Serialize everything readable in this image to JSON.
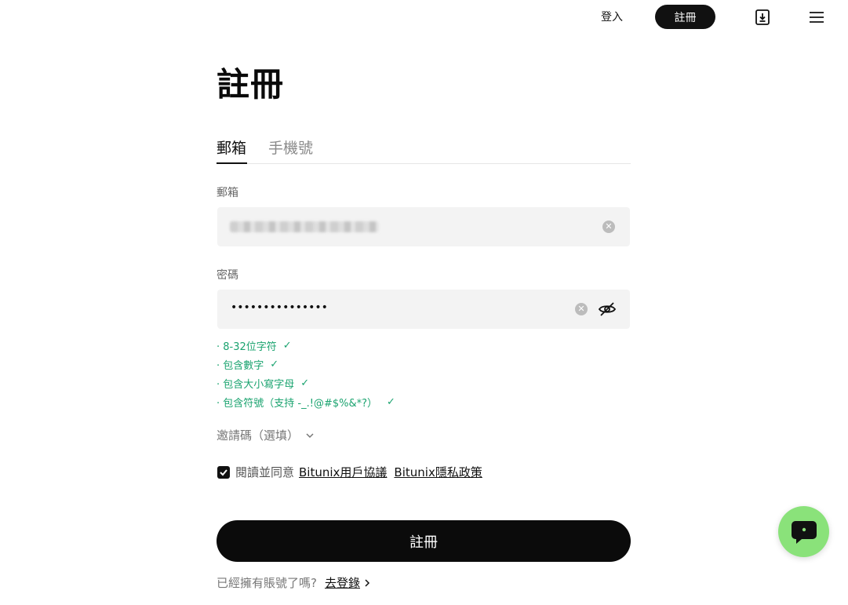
{
  "nav": {
    "login_label": "登入",
    "register_label": "註冊",
    "download_icon": "download-icon",
    "menu_icon": "menu-icon"
  },
  "page": {
    "title": "註冊"
  },
  "tabs": [
    {
      "label": "郵箱",
      "active": true
    },
    {
      "label": "手機號",
      "active": false
    }
  ],
  "form": {
    "email_label": "郵箱",
    "password_label": "密碼",
    "password_mask": "•••••••••••••••",
    "rules": [
      "· 8-32位字符",
      "· 包含數字",
      "· 包含大小寫字母",
      "· 包含符號（支持 -_.!@#$%&*?）"
    ],
    "rule_check": "✓",
    "invite_label": "邀請碼（選填）",
    "agree_text": "閱讀並同意",
    "agree_link_terms": "Bitunix用戶協議",
    "agree_link_privacy": "Bitunix隱私政策",
    "agree_checked": true,
    "submit_label": "註冊",
    "have_account_text": "已經擁有賬號了嗎?",
    "login_link": "去登錄"
  },
  "colors": {
    "primary": "#0b0b0b",
    "success": "#1aa36f",
    "chat_fab": "#8ae27a",
    "field_bg": "#f3f3f3"
  }
}
